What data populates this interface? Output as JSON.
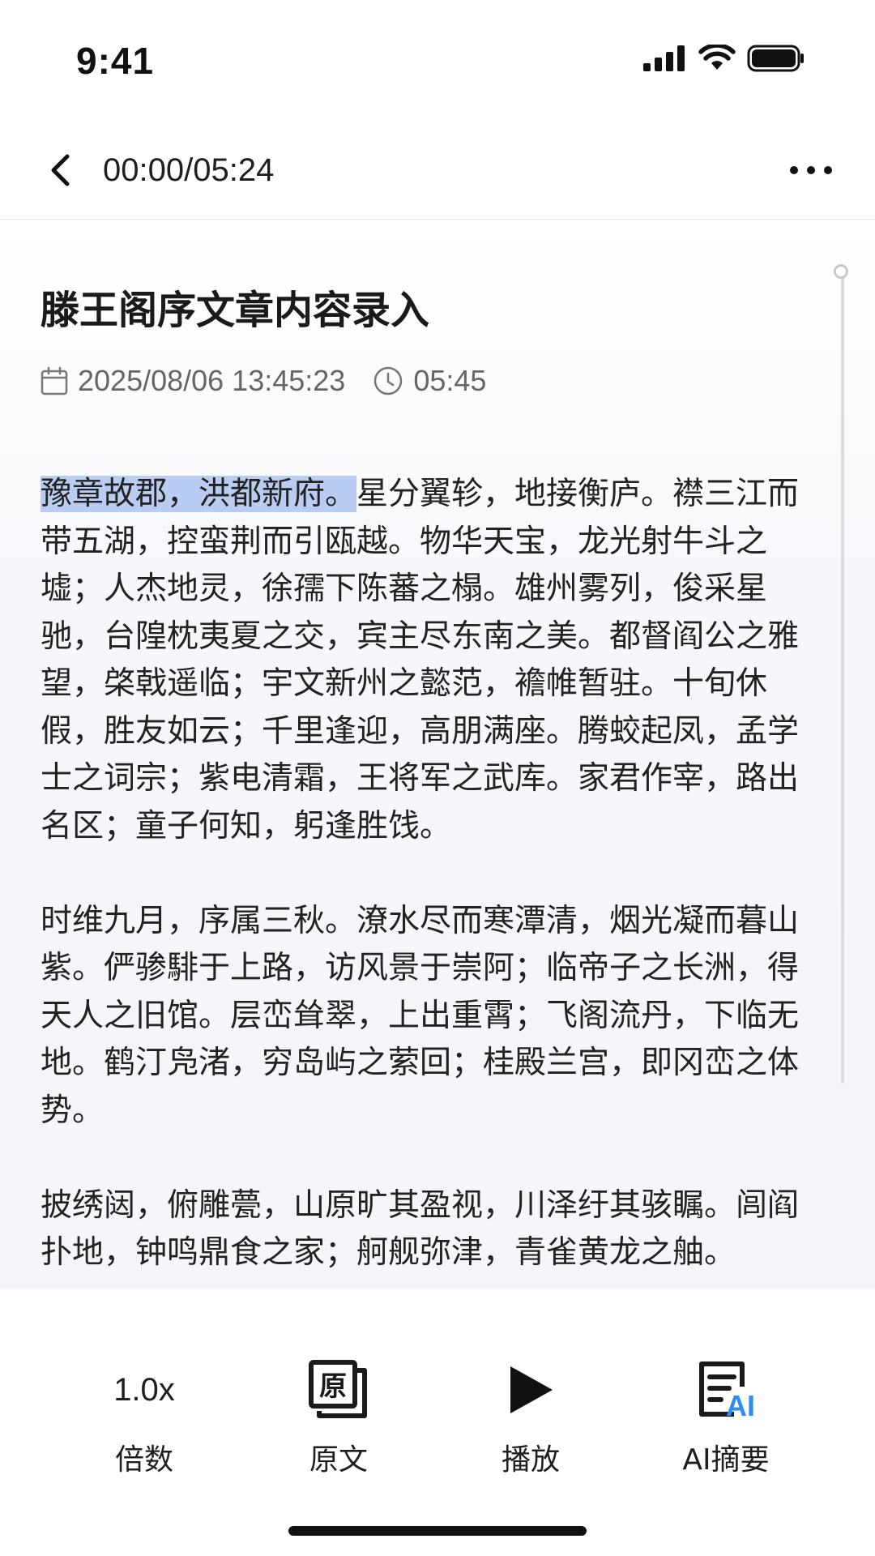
{
  "status_bar": {
    "time": "9:41"
  },
  "header": {
    "progress_time": "00:00/05:24"
  },
  "document": {
    "title": "滕王阁序文章内容录入",
    "datetime": "2025/08/06 13:45:23",
    "duration": "05:45",
    "paragraph1_highlight": "豫章故郡，洪都新府。",
    "paragraph1_rest": "星分翼轸，地接衡庐。襟三江而带五湖，控蛮荆而引瓯越。物华天宝，龙光射牛斗之墟；人杰地灵，徐孺下陈蕃之榻。雄州雾列，俊采星驰，台隍枕夷夏之交，宾主尽东南之美。都督阎公之雅望，棨戟遥临；宇文新州之懿范，襜帷暂驻。十旬休假，胜友如云；千里逢迎，高朋满座。腾蛟起凤，孟学士之词宗；紫电清霜，王将军之武库。家君作宰，路出名区；童子何知，躬逢胜饯。",
    "paragraph2": "时维九月，序属三秋。潦水尽而寒潭清，烟光凝而暮山紫。俨骖騑于上路，访风景于崇阿；临帝子之长洲，得天人之旧馆。层峦耸翠，上出重霄；飞阁流丹，下临无地。鹤汀凫渚，穷岛屿之萦回；桂殿兰宫，即冈峦之体势。",
    "paragraph3": "披绣闼，俯雕甍，山原旷其盈视，川泽纡其骇瞩。闾阎扑地，钟鸣鼎食之家；舸舰弥津，青雀黄龙之舳。"
  },
  "toolbar": {
    "speed_value": "1.0x",
    "speed_label": "倍数",
    "original_icon_char": "原",
    "original_label": "原文",
    "play_label": "播放",
    "ai_icon_text": "AI",
    "ai_label": "AI摘要"
  },
  "colors": {
    "highlight": "#b9cdf2",
    "ai_accent": "#2f8cf0"
  }
}
